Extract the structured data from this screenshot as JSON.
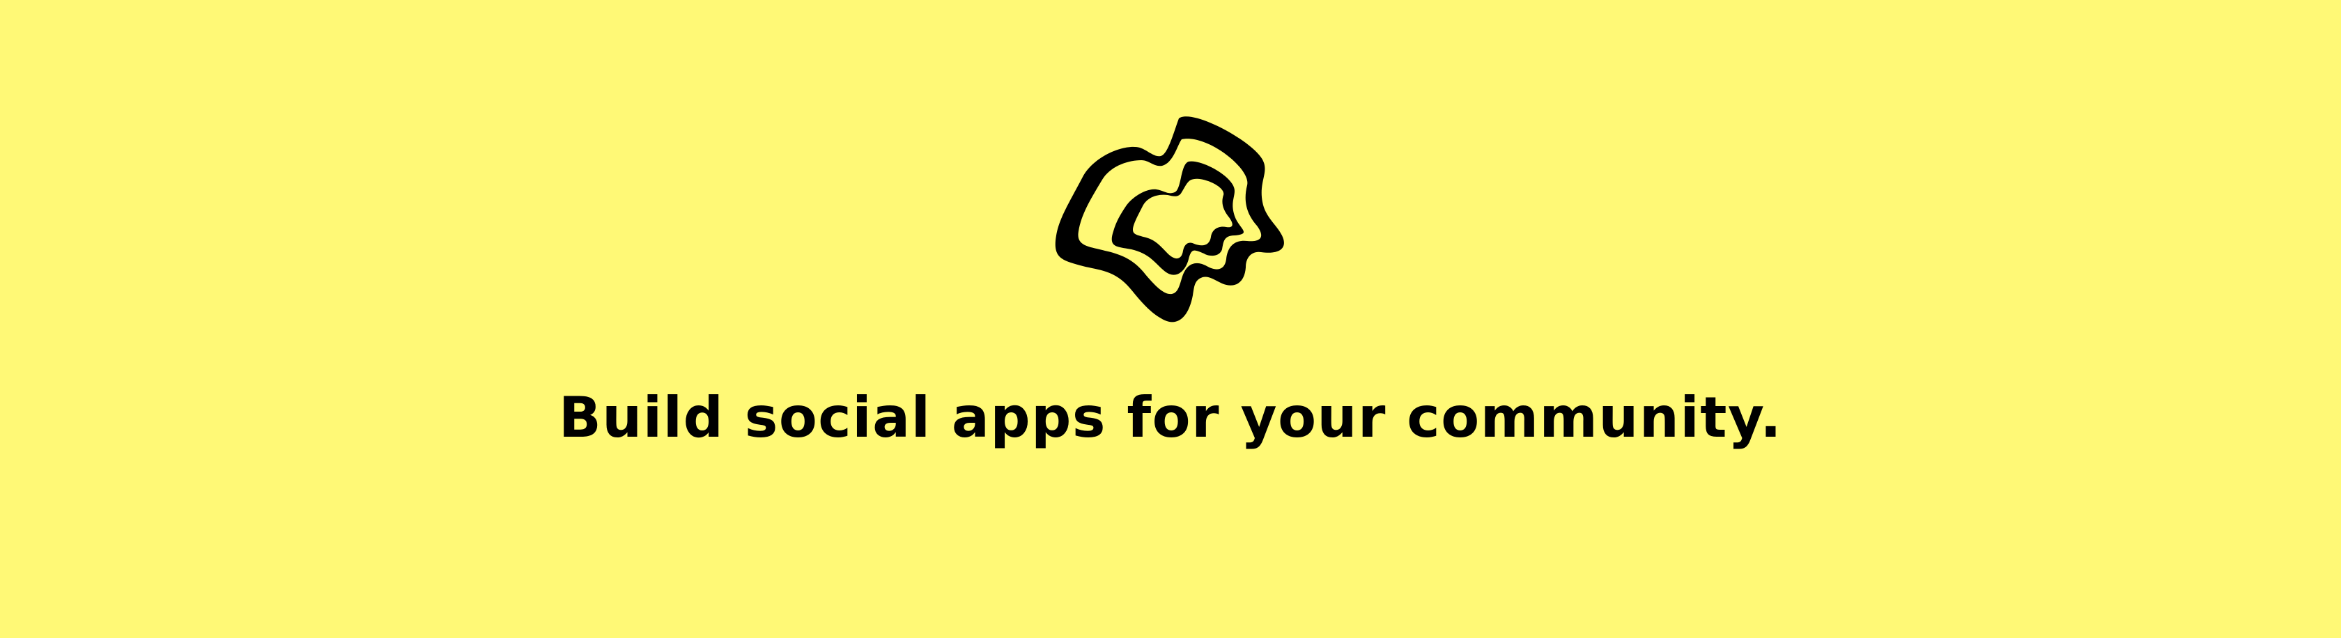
{
  "banner": {
    "background_color": "#FFF976",
    "logo_icon": "blob-swirl-logo-icon",
    "ink_color": "#000000",
    "tagline": "Build social apps for your community."
  }
}
